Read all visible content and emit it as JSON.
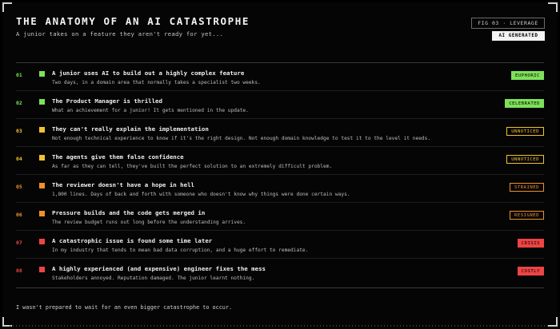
{
  "header": {
    "title": "THE ANATOMY OF AN AI CATASTROPHE",
    "subtitle": "A junior takes on a feature they aren't ready for yet...",
    "fig_label": "FIG 03 · LEVERAGE",
    "ai_badge": "AI GENERATED"
  },
  "rows": [
    {
      "num": "01",
      "title": "A junior uses AI to build out a highly complex feature",
      "desc": "Two days, in a domain area that normally takes a specialist two weeks.",
      "badge": "EUPHORIC",
      "color": "#7ee05a",
      "style": "filled"
    },
    {
      "num": "02",
      "title": "The Product Manager is thrilled",
      "desc": "What an achievement for a junior! It gets mentioned in the update.",
      "badge": "CELEBRATED",
      "color": "#7ee05a",
      "style": "filled"
    },
    {
      "num": "03",
      "title": "They can't really explain the implementation",
      "desc": "Not enough technical experience to know if it's the right design. Not enough domain knowledge to test it to the level it needs.",
      "badge": "UNNOTICED",
      "color": "#f2c230",
      "style": "outline"
    },
    {
      "num": "04",
      "title": "The agents give them false confidence",
      "desc": "As far as they can tell, they've built the perfect solution to an extremely difficult problem.",
      "badge": "UNNOTICED",
      "color": "#f2c230",
      "style": "outline"
    },
    {
      "num": "05",
      "title": "The reviewer doesn't have a hope in hell",
      "desc": "1,800 lines. Days of back and forth with someone who doesn't know why things were done certain ways.",
      "badge": "STRAINED",
      "color": "#f0902a",
      "style": "outline"
    },
    {
      "num": "06",
      "title": "Pressure builds and the code gets merged in",
      "desc": "The review budget runs out long before the understanding arrives.",
      "badge": "RESIGNED",
      "color": "#f0902a",
      "style": "outline"
    },
    {
      "num": "07",
      "title": "A catastrophic issue is found some time later",
      "desc": "In my industry that tends to mean bad data corruption, and a huge effort to remediate.",
      "badge": "CRISIS",
      "color": "#ee4444",
      "style": "filled"
    },
    {
      "num": "08",
      "title": "A highly experienced (and expensive) engineer fixes the mess",
      "desc": "Stakeholders annoyed. Reputation damaged. The junior learnt nothing.",
      "badge": "COSTLY",
      "color": "#ee4444",
      "style": "filled"
    }
  ],
  "footer": {
    "text": "I wasn't prepared to wait for an even bigger catastrophe to occur."
  }
}
